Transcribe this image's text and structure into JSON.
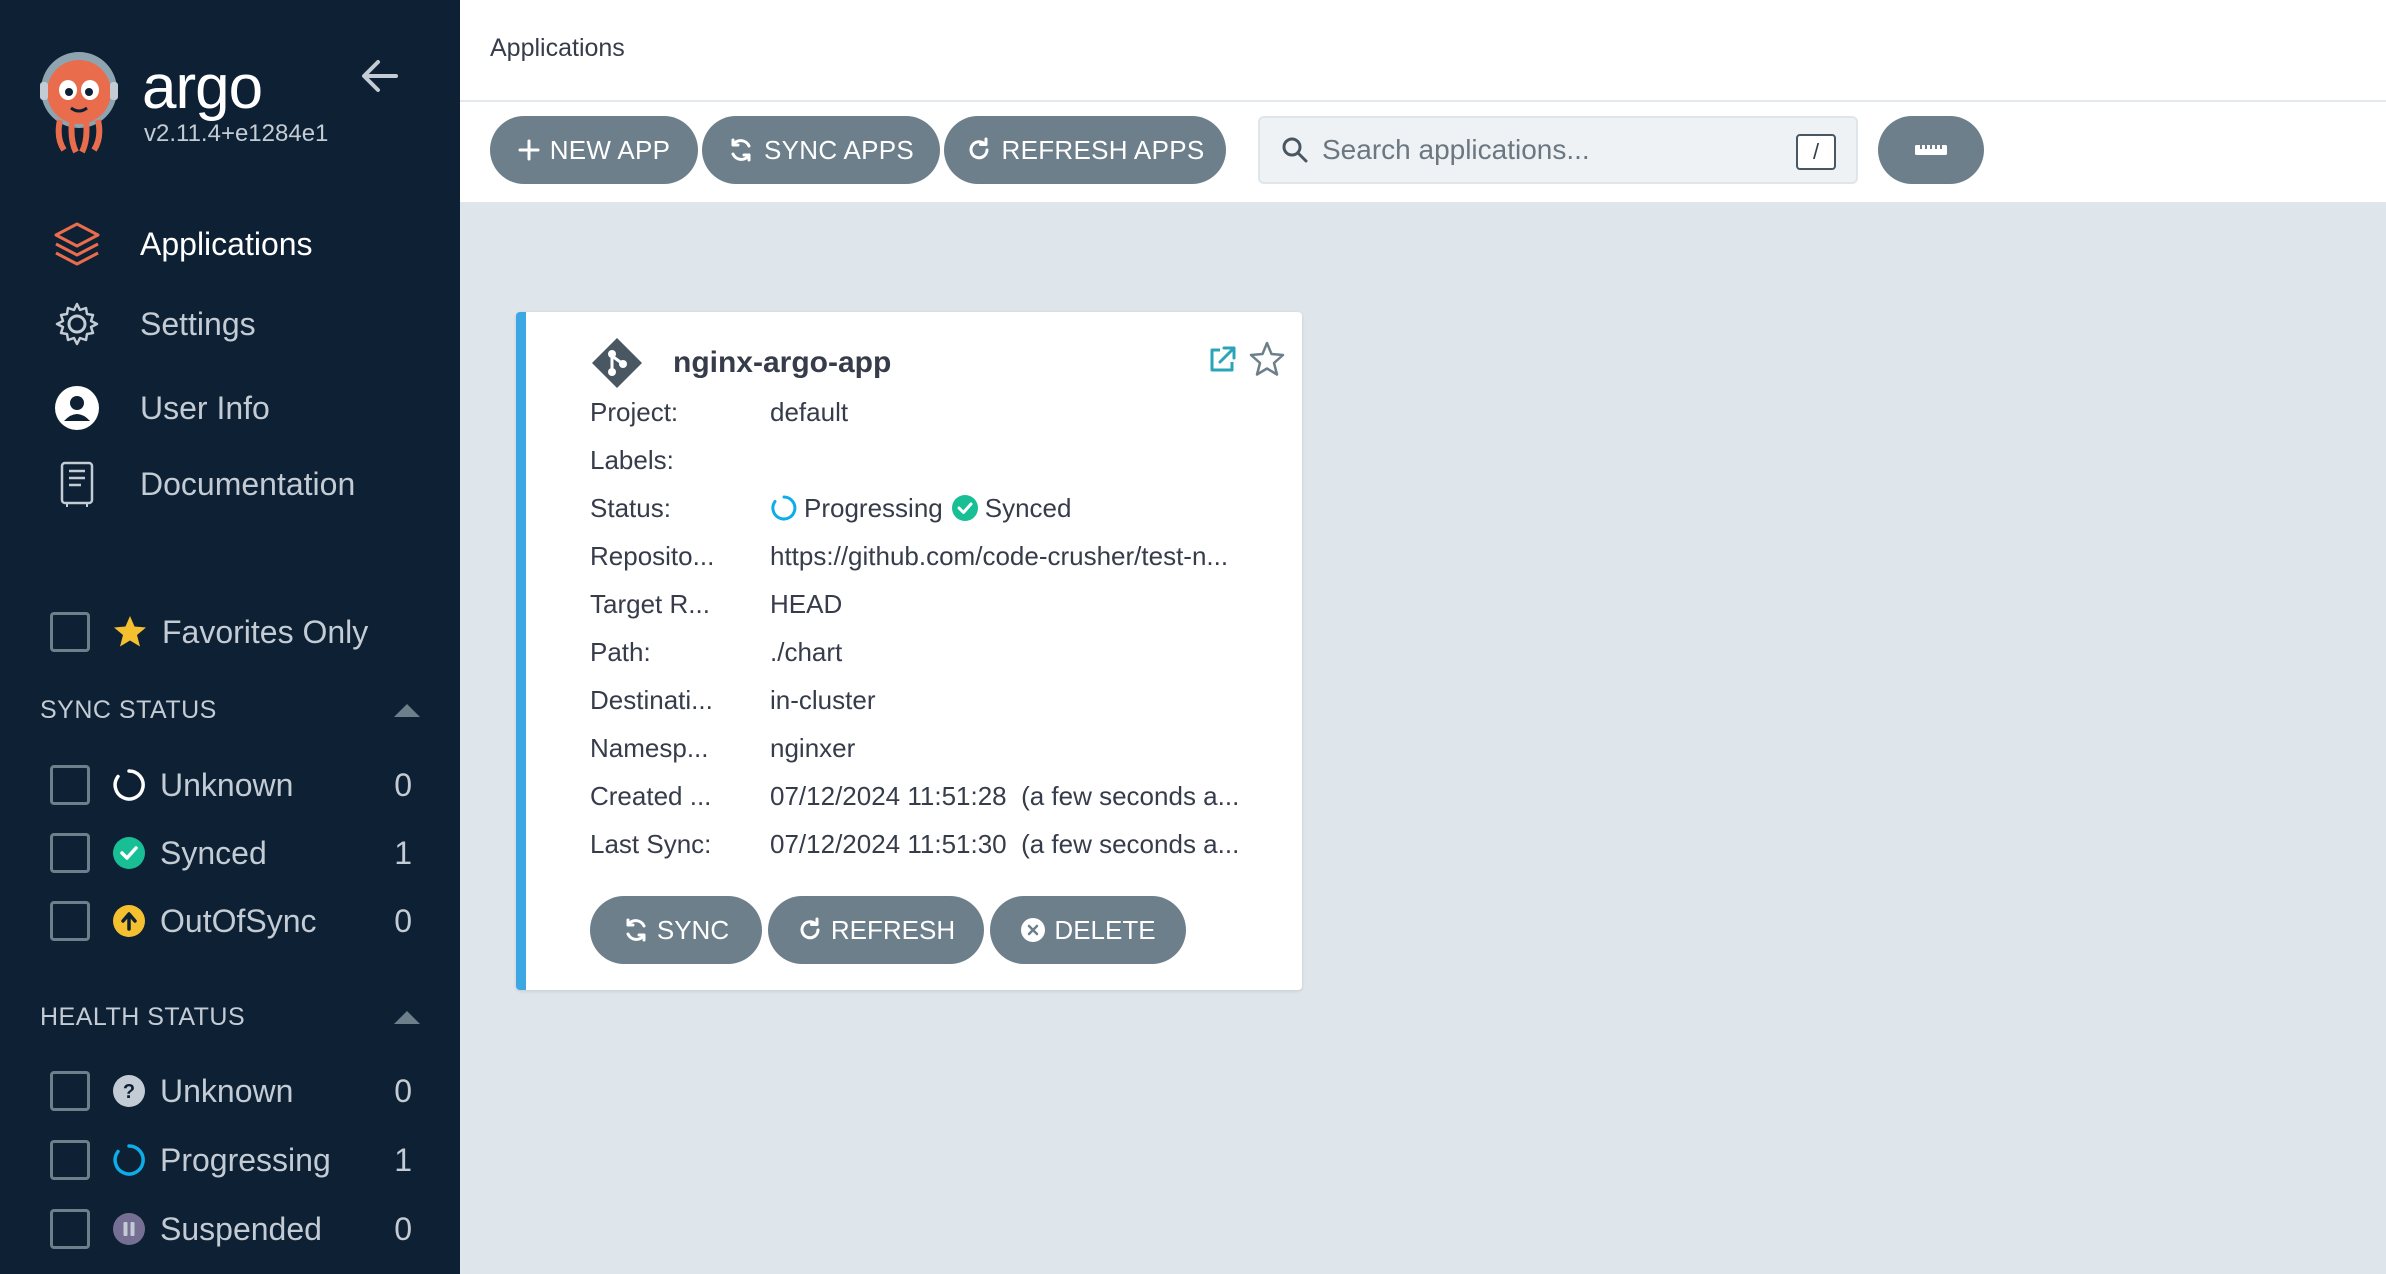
{
  "sidebar": {
    "brand": "argo",
    "version": "v2.11.4+e1284e1",
    "nav": [
      {
        "label": "Applications",
        "icon": "layers-icon",
        "active": true
      },
      {
        "label": "Settings",
        "icon": "gear-icon",
        "active": false
      },
      {
        "label": "User Info",
        "icon": "user-circle-icon",
        "active": false
      },
      {
        "label": "Documentation",
        "icon": "book-icon",
        "active": false
      }
    ],
    "favorites_label": "Favorites Only",
    "sync_status": {
      "title": "SYNC STATUS",
      "items": [
        {
          "label": "Unknown",
          "count": "0",
          "icon": "circle-outline-icon"
        },
        {
          "label": "Synced",
          "count": "1",
          "icon": "check-circle-icon"
        },
        {
          "label": "OutOfSync",
          "count": "0",
          "icon": "arrow-up-circle-icon"
        }
      ]
    },
    "health_status": {
      "title": "HEALTH STATUS",
      "items": [
        {
          "label": "Unknown",
          "count": "0",
          "icon": "question-circle-icon"
        },
        {
          "label": "Progressing",
          "count": "1",
          "icon": "spinner-icon"
        },
        {
          "label": "Suspended",
          "count": "0",
          "icon": "pause-circle-icon"
        }
      ]
    }
  },
  "header": {
    "title": "Applications"
  },
  "toolbar": {
    "new_app": "NEW APP",
    "sync_apps": "SYNC APPS",
    "refresh_apps": "REFRESH APPS",
    "search_placeholder": "Search applications...",
    "search_shortcut": "/"
  },
  "app_card": {
    "name": "nginx-argo-app",
    "fields": [
      {
        "key": "Project:",
        "value": "default"
      },
      {
        "key": "Labels:",
        "value": ""
      },
      {
        "key": "Status:",
        "health": "Progressing",
        "sync": "Synced"
      },
      {
        "key": "Reposito...",
        "value": "https://github.com/code-crusher/test-n..."
      },
      {
        "key": "Target R...",
        "value": "HEAD"
      },
      {
        "key": "Path:",
        "value": "./chart"
      },
      {
        "key": "Destinati...",
        "value": "in-cluster"
      },
      {
        "key": "Namesp...",
        "value": "nginxer"
      },
      {
        "key": "Created ...",
        "value": "07/12/2024 11:51:28  (a few seconds a..."
      },
      {
        "key": "Last Sync:",
        "value": "07/12/2024 11:51:30  (a few seconds a..."
      }
    ],
    "buttons": {
      "sync": "SYNC",
      "refresh": "REFRESH",
      "delete": "DELETE"
    }
  },
  "colors": {
    "sidebar_bg": "#0e2033",
    "accent_orange": "#e96d4c",
    "synced_green": "#18be94",
    "progressing_blue": "#0dadea",
    "outofsync_yellow": "#f4c030",
    "suspended_purple": "#766f94",
    "button_gray": "#6d7f8b",
    "card_border_blue": "#3da7e4"
  }
}
